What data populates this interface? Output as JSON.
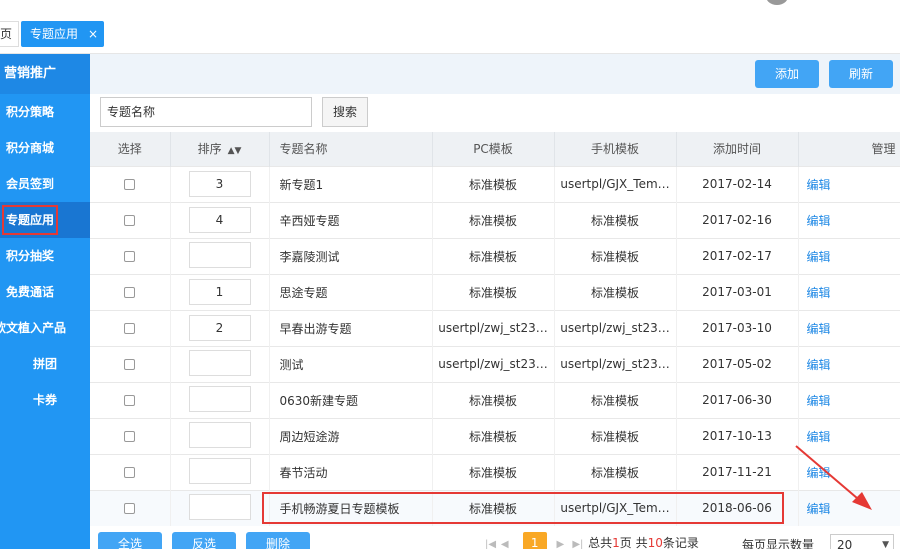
{
  "tabs": {
    "prev_label": "页",
    "active_label": "专题应用",
    "close_glyph": "×"
  },
  "sidebar": {
    "header": "营销推广",
    "items": [
      {
        "label": "积分策略"
      },
      {
        "label": "积分商城"
      },
      {
        "label": "会员签到"
      },
      {
        "label": "专题应用"
      },
      {
        "label": "积分抽奖"
      },
      {
        "label": "免费通话"
      },
      {
        "label": "软文植入产品"
      },
      {
        "label": "拼团"
      },
      {
        "label": "卡券"
      }
    ]
  },
  "toolbar": {
    "add_label": "添加",
    "refresh_label": "刷新"
  },
  "search": {
    "value": "专题名称",
    "button_label": "搜索"
  },
  "table": {
    "headers": {
      "select": "选择",
      "sort": "排序",
      "name": "专题名称",
      "pc": "PC模板",
      "mobile": "手机模板",
      "time": "添加时间",
      "manage": "管理"
    },
    "sort_glyph": "▲▼",
    "rows": [
      {
        "sort": "3",
        "name": "新专题1",
        "pc": "标准模板",
        "mobile": "usertpl/GJX_Tem…",
        "time": "2017-02-14",
        "action": "编辑"
      },
      {
        "sort": "4",
        "name": "辛西娅专题",
        "pc": "标准模板",
        "mobile": "标准模板",
        "time": "2017-02-16",
        "action": "编辑"
      },
      {
        "sort": "",
        "name": "李嘉陵测试",
        "pc": "标准模板",
        "mobile": "标准模板",
        "time": "2017-02-17",
        "action": "编辑"
      },
      {
        "sort": "1",
        "name": "思途专题",
        "pc": "标准模板",
        "mobile": "标准模板",
        "time": "2017-03-01",
        "action": "编辑"
      },
      {
        "sort": "2",
        "name": "早春出游专题",
        "pc": "usertpl/zwj_st23…",
        "mobile": "usertpl/zwj_st23…",
        "time": "2017-03-10",
        "action": "编辑"
      },
      {
        "sort": "",
        "name": "测试",
        "pc": "usertpl/zwj_st23…",
        "mobile": "usertpl/zwj_st23…",
        "time": "2017-05-02",
        "action": "编辑"
      },
      {
        "sort": "",
        "name": "0630新建专题",
        "pc": "标准模板",
        "mobile": "标准模板",
        "time": "2017-06-30",
        "action": "编辑"
      },
      {
        "sort": "",
        "name": "周边短途游",
        "pc": "标准模板",
        "mobile": "标准模板",
        "time": "2017-10-13",
        "action": "编辑"
      },
      {
        "sort": "",
        "name": "春节活动",
        "pc": "标准模板",
        "mobile": "标准模板",
        "time": "2017-11-21",
        "action": "编辑"
      },
      {
        "sort": "",
        "name": "手机畅游夏日专题模板",
        "pc": "标准模板",
        "mobile": "usertpl/GJX_Tem…",
        "time": "2018-06-06",
        "action": "编辑"
      }
    ]
  },
  "bottom": {
    "select_all": "全选",
    "invert": "反选",
    "delete": "删除",
    "page_current": "1",
    "total_prefix": "总共",
    "total_pages": "1",
    "total_mid": "页 共",
    "total_records": "10",
    "total_suffix": "条记录",
    "per_page_label": "每页显示数量",
    "per_page_value": "20"
  },
  "colors": {
    "primary": "#2196f3",
    "highlight_red": "#e53935",
    "pager_current": "#f9a825"
  }
}
